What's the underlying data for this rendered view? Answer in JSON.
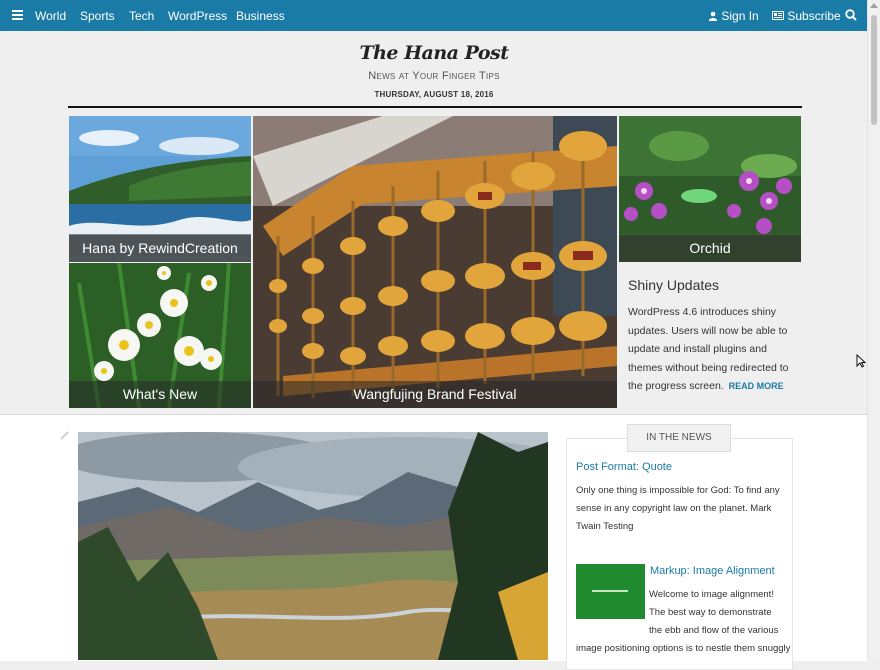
{
  "nav": {
    "left": [
      "World",
      "Sports",
      "Tech",
      "WordPress",
      "Business"
    ],
    "signin": "Sign In",
    "subscribe": "Subscribe"
  },
  "site": {
    "title": "The Hana Post",
    "tagline": "News at Your Finger Tips",
    "date": "THURSDAY, AUGUST 18, 2016"
  },
  "featured": {
    "hana": "Hana by RewindCreation",
    "whats_new": "What's New",
    "festival": "Wangfujing Brand Festival",
    "orchid": "Orchid"
  },
  "shiny": {
    "title": "Shiny Updates",
    "text": "WordPress 4.6 introduces shiny updates. Users will now be able to update and install plugins and themes without being redirected to the progress screen.",
    "read_more": "READ MORE"
  },
  "in_the_news": {
    "tab": "IN THE NEWS",
    "post1_title": "Post Format: Quote",
    "post1_text": "Only one thing is impossible for God: To find any sense in any copyright law on the planet. Mark Twain Testing",
    "post2_title": "Markup: Image Alignment",
    "post2_text_a": "Welcome to image alignment! The best way to demonstrate the ebb and flow of the various",
    "post2_text_b": "image positioning options is to nestle them snuggly"
  },
  "colors": {
    "accent": "#1b7ba7",
    "background": "#efefef"
  }
}
